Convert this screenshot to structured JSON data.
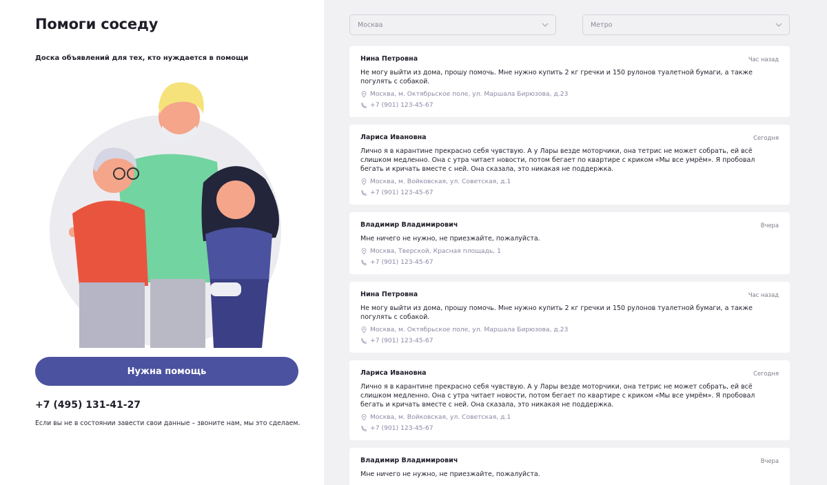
{
  "sidebar": {
    "title": "Помоги соседу",
    "subtitle": "Доска объявлений для тех, кто нуждается в помощи",
    "button_label": "Нужна помощь",
    "phone": "+7 (495) 131-41-27",
    "note": "Если вы не в состоянии завести свои данные – звоните нам, мы это сделаем."
  },
  "filters": {
    "city": "Москва",
    "metro": "Метро"
  },
  "colors": {
    "accent": "#4b529f",
    "panel_bg": "#f1f1f4",
    "meta_text": "#8a89a6"
  },
  "posts": [
    {
      "name": "Нина Петровна",
      "time": "Час назад",
      "text": "Не могу выйти из дома, прошу помочь. Мне нужно купить 2 кг гречки и 150 рулонов туалетной бумаги, а также погулять с собакой.",
      "address": "Москва, м. Октябрьское поле, ул. Маршала Бирюзова, д.23",
      "phone": "+7 (901) 123-45-67"
    },
    {
      "name": "Лариса Ивановна",
      "time": "Сегодня",
      "text": "Лично я в карантине прекрасно себя чувствую. А у Лары везде моторчики, она тетрис не может собрать, ей всё слишком медленно. Она с утра читает новости, потом бегает по квартире с криком «Мы все умрём». Я пробовал бегать и кричать вместе с ней. Она сказала, это никакая не поддержка.",
      "address": "Москва, м. Войковская, ул. Советская, д.1",
      "phone": "+7 (901) 123-45-67"
    },
    {
      "name": "Владимир Владимирович",
      "time": "Вчера",
      "text": "Мне ничего не нужно, не приезжайте, пожалуйста.",
      "address": "Москва, Тверской, Красная площадь, 1",
      "phone": "+7 (901) 123-45-67"
    },
    {
      "name": "Нина Петровна",
      "time": "Час назад",
      "text": "Не могу выйти из дома, прошу помочь. Мне нужно купить 2 кг гречки и 150 рулонов туалетной бумаги, а также погулять с собакой.",
      "address": "Москва, м. Октябрьское поле, ул. Маршала Бирюзова, д.23",
      "phone": "+7 (901) 123-45-67"
    },
    {
      "name": "Лариса Ивановна",
      "time": "Сегодня",
      "text": "Лично я в карантине прекрасно себя чувствую. А у Лары везде моторчики, она тетрис не может собрать, ей всё слишком медленно. Она с утра читает новости, потом бегает по квартире с криком «Мы все умрём». Я пробовал бегать и кричать вместе с ней. Она сказала, это никакая не поддержка.",
      "address": "Москва, м. Войковская, ул. Советская, д.1",
      "phone": "+7 (901) 123-45-67"
    },
    {
      "name": "Владимир Владимирович",
      "time": "Вчера",
      "text": "Мне ничего не нужно, не приезжайте, пожалуйста.",
      "address": "",
      "phone": ""
    }
  ]
}
